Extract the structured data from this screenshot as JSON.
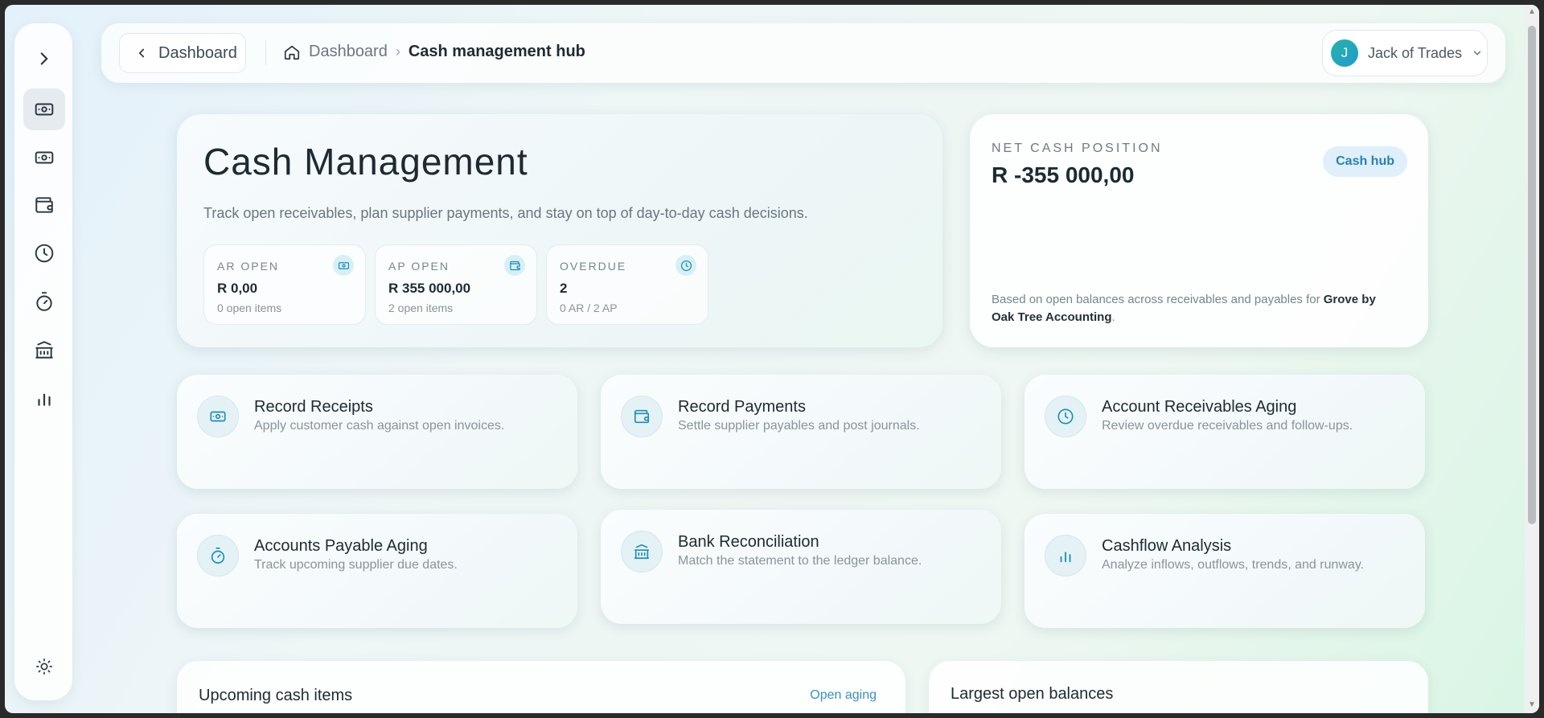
{
  "header": {
    "back_label": "Dashboard",
    "breadcrumb_home": "Dashboard",
    "breadcrumb_current": "Cash management hub",
    "user_initial": "J",
    "user_name": "Jack of Trades"
  },
  "sidebar": {
    "icons": [
      "cash-icon",
      "cash-icon",
      "wallet-icon",
      "clock-icon",
      "stopwatch-icon",
      "bank-icon",
      "bar-chart-icon"
    ],
    "theme_icon": "sun-icon"
  },
  "hero": {
    "title": "Cash Management",
    "subtitle": "Track open receivables, plan supplier payments, and stay on top of day-to-day cash decisions.",
    "stats": [
      {
        "label": "AR OPEN",
        "value": "R 0,00",
        "meta": "0 open items",
        "icon": "cash-icon"
      },
      {
        "label": "AP OPEN",
        "value": "R 355 000,00",
        "meta": "2 open items",
        "icon": "wallet-icon"
      },
      {
        "label": "OVERDUE",
        "value": "2",
        "meta": "0 AR / 2 AP",
        "icon": "clock-icon"
      }
    ]
  },
  "net": {
    "label": "NET CASH POSITION",
    "value": "R -355 000,00",
    "badge": "Cash hub",
    "note_prefix": "Based on open balances across receivables and payables for ",
    "note_company": "Grove by Oak Tree Accounting",
    "note_suffix": "."
  },
  "actions": [
    {
      "title": "Record Receipts",
      "desc": "Apply customer cash against open invoices.",
      "icon": "cash-icon"
    },
    {
      "title": "Record Payments",
      "desc": "Settle supplier payables and post journals.",
      "icon": "wallet-icon"
    },
    {
      "title": "Account Receivables Aging",
      "desc": "Review overdue receivables and follow-ups.",
      "icon": "clock-icon"
    },
    {
      "title": "Accounts Payable Aging",
      "desc": "Track upcoming supplier due dates.",
      "icon": "stopwatch-icon"
    },
    {
      "title": "Bank Reconciliation",
      "desc": "Match the statement to the ledger balance.",
      "icon": "bank-icon"
    },
    {
      "title": "Cashflow Analysis",
      "desc": "Analyze inflows, outflows, trends, and runway.",
      "icon": "bar-chart-icon"
    }
  ],
  "bottom": {
    "upcoming_title": "Upcoming cash items",
    "upcoming_link": "Open aging",
    "largest_title": "Largest open balances"
  },
  "colors": {
    "accent": "#1b8fb5",
    "link": "#3a8fc6",
    "avatar": "#27b3a8"
  }
}
